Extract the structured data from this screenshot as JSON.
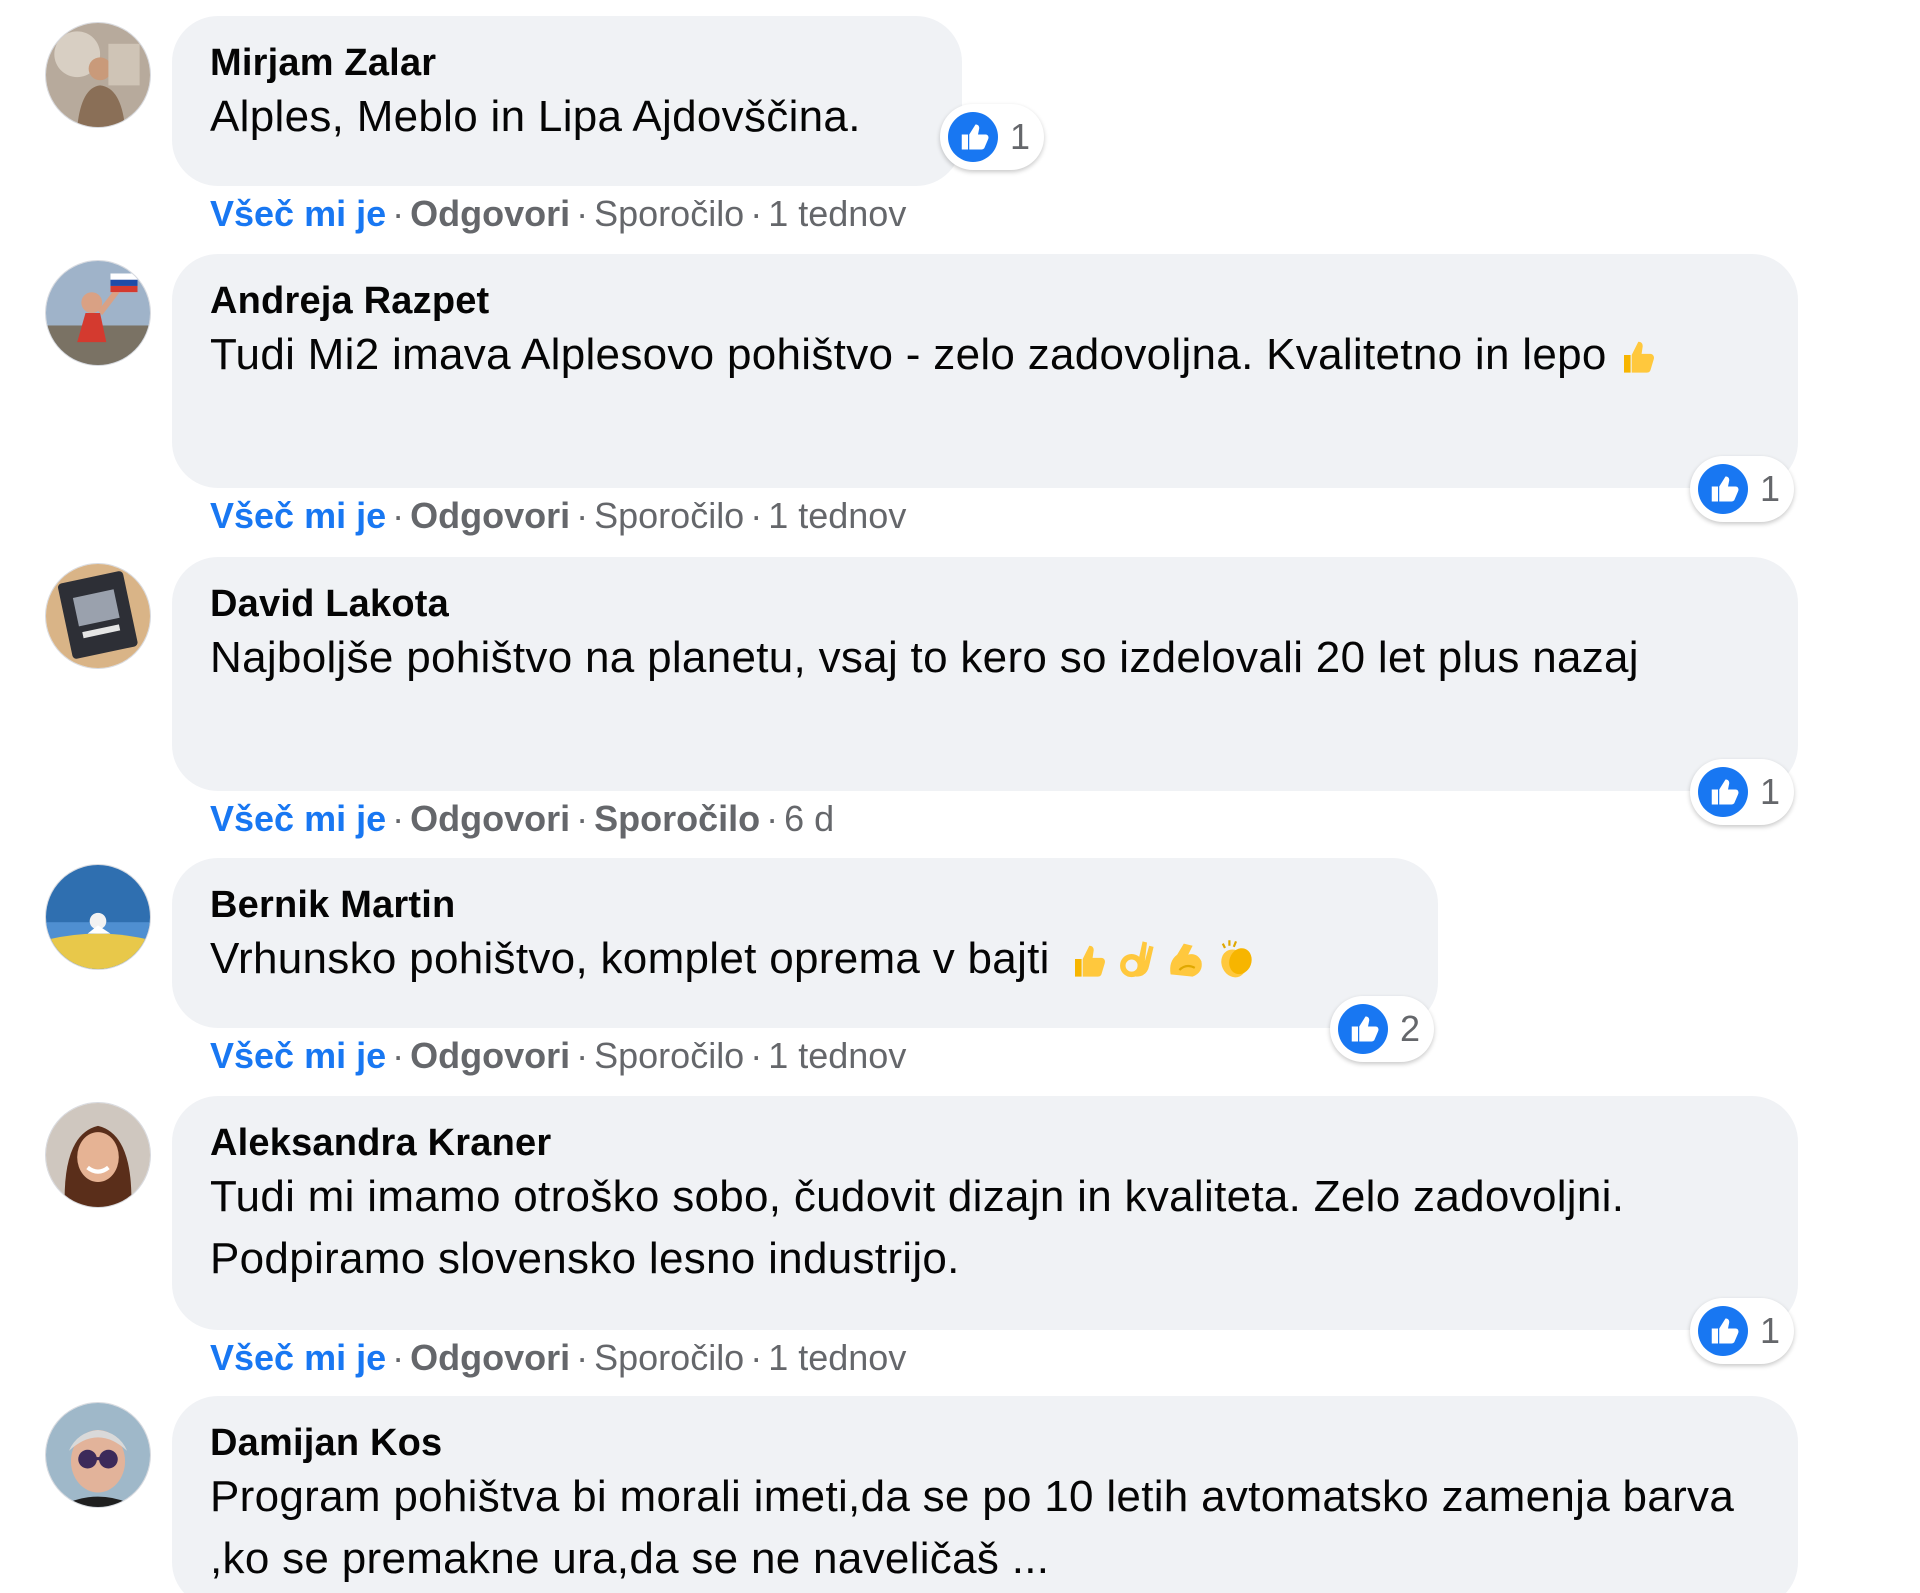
{
  "actions": {
    "like": "Všeč mi je",
    "reply": "Odgovori",
    "message": "Sporočilo",
    "separator": "·"
  },
  "colors": {
    "link_blue": "#1877f2",
    "bubble_bg": "#f0f2f5",
    "muted_text": "#65676b"
  },
  "comments": [
    {
      "author": "Mirjam Zalar",
      "text": "Alples, Meblo in Lipa Ajdovščina.",
      "emojis": [],
      "reaction_icon": "like-icon",
      "reaction_count": "1",
      "time": "1 tednov"
    },
    {
      "author": "Andreja Razpet",
      "text": "Tudi Mi2 imava Alplesovo pohištvo - zelo zadovoljna. Kvalitetno in lepo",
      "emojis": [
        "thumbs-up"
      ],
      "reaction_icon": "like-icon",
      "reaction_count": "1",
      "time": "1 tednov"
    },
    {
      "author": "David Lakota",
      "text": "Najboljše pohištvo na planetu, vsaj to kero so izdelovali 20 let plus nazaj",
      "emojis": [],
      "reaction_icon": "like-icon",
      "reaction_count": "1",
      "time": "6 d"
    },
    {
      "author": "Bernik Martin",
      "text": "Vrhunsko pohištvo, komplet oprema v bajti",
      "emojis": [
        "thumbs-up",
        "ok-hand",
        "flexed-biceps",
        "clapping-hands"
      ],
      "reaction_icon": "like-icon",
      "reaction_count": "2",
      "time": "1 tednov"
    },
    {
      "author": "Aleksandra Kraner",
      "text": "Tudi mi imamo otroško sobo, čudovit dizajn in kvaliteta. Zelo zadovoljni. Podpiramo slovensko lesno industrijo.",
      "emojis": [],
      "reaction_icon": "like-icon",
      "reaction_count": "1",
      "time": "1 tednov"
    },
    {
      "author": "Damijan Kos",
      "text": "Program pohištva bi morali imeti,da se po 10 letih avtomatsko zamenja barva ,ko se premakne ura,da se ne naveličaš ...",
      "emojis": []
    }
  ]
}
